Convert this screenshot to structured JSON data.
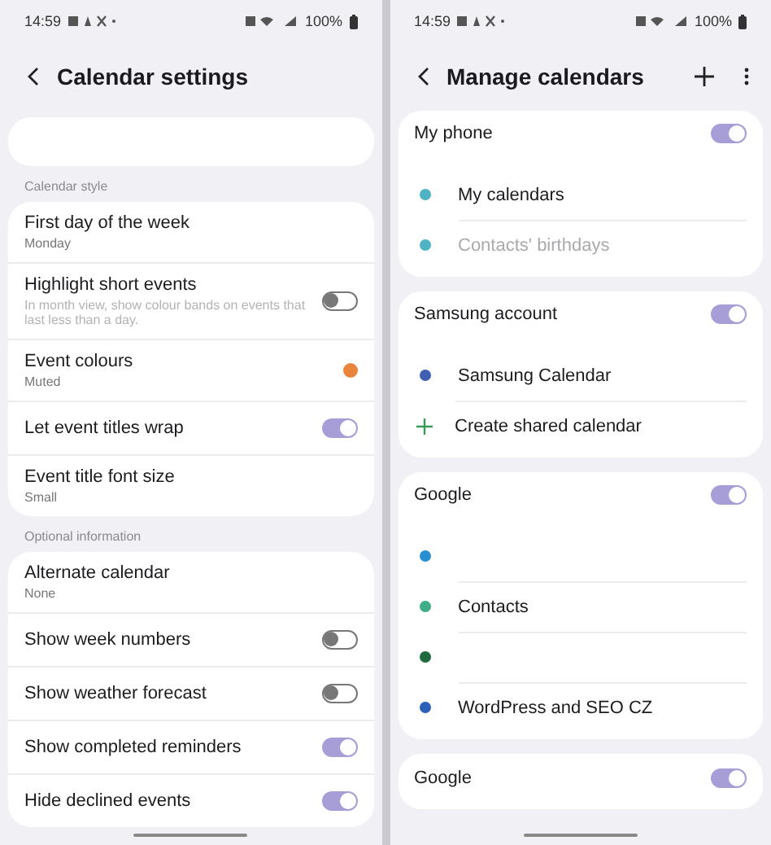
{
  "calendar_settings": {
    "status_bar": {
      "time": "14:59",
      "battery": "100%"
    },
    "title": "Calendar settings",
    "sections": [
      {
        "kind": "blank"
      },
      {
        "kind": "group",
        "label": "Calendar style",
        "items": [
          {
            "kind": "value",
            "title": "First day of the week",
            "subtitle": "Monday"
          },
          {
            "kind": "toggle",
            "title": "Highlight short events",
            "subtitle": "In month view, show colour bands on events that last less than a day.",
            "on": false
          },
          {
            "kind": "color",
            "title": "Event colours",
            "subtitle": "Muted",
            "color": "#e8843c"
          },
          {
            "kind": "toggle",
            "title": "Let event titles wrap",
            "on": true
          },
          {
            "kind": "value",
            "title": "Event title font size",
            "subtitle": "Small"
          }
        ]
      },
      {
        "kind": "group",
        "label": "Optional information",
        "items": [
          {
            "kind": "value",
            "title": "Alternate calendar",
            "subtitle": "None"
          },
          {
            "kind": "toggle",
            "title": "Show week numbers",
            "on": false
          },
          {
            "kind": "toggle",
            "title": "Show weather forecast",
            "on": false
          },
          {
            "kind": "toggle",
            "title": "Show completed reminders",
            "on": true
          },
          {
            "kind": "toggle",
            "title": "Hide declined events",
            "on": true
          }
        ]
      }
    ]
  },
  "manage_calendars": {
    "status_bar": {
      "time": "14:59",
      "battery": "100%"
    },
    "title": "Manage calendars",
    "accounts": [
      {
        "name": "My phone",
        "on": true,
        "calendars": [
          {
            "kind": "calendar",
            "name": "My calendars",
            "color": "#4fb3c4",
            "disabled": false
          },
          {
            "kind": "calendar",
            "name": "Contacts' birthdays",
            "color": "#4fb3c4",
            "disabled": true
          }
        ]
      },
      {
        "name": "Samsung account",
        "on": true,
        "calendars": [
          {
            "kind": "calendar",
            "name": "Samsung Calendar",
            "color": "#3f5fb0",
            "disabled": false
          },
          {
            "kind": "action",
            "name": "Create shared calendar"
          }
        ]
      },
      {
        "name": "Google",
        "on": true,
        "calendars": [
          {
            "kind": "calendar",
            "color": "#2a8fd0"
          },
          {
            "kind": "calendar",
            "name": "Contacts",
            "color": "#3fae86",
            "disabled": false
          },
          {
            "kind": "calendar",
            "color": "#1f6b3f"
          },
          {
            "kind": "calendar",
            "name": "WordPress and SEO CZ",
            "color": "#2b5fb8",
            "disabled": false
          }
        ]
      },
      {
        "name": "Google",
        "on": true
      }
    ]
  }
}
